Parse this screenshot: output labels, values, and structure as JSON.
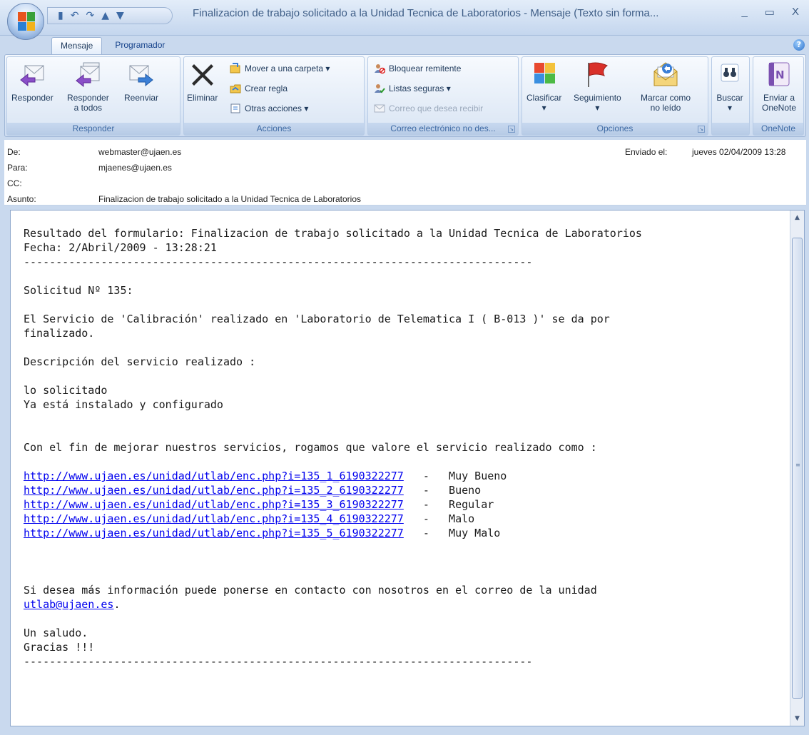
{
  "window": {
    "title": "Finalizacion de trabajo solicitado a la Unidad Tecnica de Laboratorios - Mensaje (Texto sin forma...",
    "minimize": "_",
    "maximize": "▭",
    "close": "X"
  },
  "qat": {
    "save": "▮",
    "undo": "↶",
    "redo": "↷",
    "up": "▲",
    "down": "▼",
    "customize": "₹"
  },
  "tabs": [
    {
      "label": "Mensaje",
      "active": true
    },
    {
      "label": "Programador",
      "active": false
    }
  ],
  "ribbon": {
    "groups": {
      "responder": "Responder",
      "acciones": "Acciones",
      "correo": "Correo electrónico no des...",
      "opciones": "Opciones",
      "buscar": "",
      "onenote": "OneNote"
    },
    "buttons": {
      "responder": "Responder",
      "responder_todos_1": "Responder",
      "responder_todos_2": "a todos",
      "reenviar": "Reenviar",
      "eliminar": "Eliminar",
      "mover": "Mover a una carpeta ▾",
      "crear_regla": "Crear regla",
      "otras_acciones": "Otras acciones ▾",
      "bloquear": "Bloquear remitente",
      "listas_seguras": "Listas seguras ▾",
      "correo_recibir": "Correo que desea recibir",
      "clasificar": "Clasificar",
      "clasificar_arrow": "▾",
      "seguimiento": "Seguimiento",
      "seguimiento_arrow": "▾",
      "marcar_1": "Marcar como",
      "marcar_2": "no leído",
      "buscar": "Buscar",
      "buscar_arrow": "▾",
      "enviar_onenote_1": "Enviar a",
      "enviar_onenote_2": "OneNote"
    }
  },
  "header": {
    "de_label": "De:",
    "de_value": "webmaster@ujaen.es",
    "para_label": "Para:",
    "para_value": "mjaenes@ujaen.es",
    "cc_label": "CC:",
    "cc_value": "",
    "asunto_label": "Asunto:",
    "asunto_value": "Finalizacion de trabajo solicitado a la Unidad Tecnica de Laboratorios",
    "enviado_label": "Enviado el:",
    "enviado_value": "jueves 02/04/2009 13:28"
  },
  "body": {
    "line1": "Resultado del formulario: Finalizacion de trabajo solicitado a la Unidad Tecnica de Laboratorios",
    "line2": "Fecha: 2/Abril/2009 - 13:28:21",
    "separator": "-------------------------------------------------------------------------------",
    "solicitud": "Solicitud Nº 135:",
    "servicio_1": "El Servicio de 'Calibración' realizado en 'Laboratorio de Telematica I ( B-013 )' se da por",
    "servicio_2": "finalizado.",
    "descripcion": "Descripción del servicio realizado :",
    "desc_1": "lo solicitado",
    "desc_2": "Ya está instalado y configurado",
    "valore": "Con el fin de mejorar nuestros servicios, rogamos que valore el servicio realizado como :",
    "ratings": [
      {
        "url": "http://www.ujaen.es/unidad/utlab/enc.php?i=135_1_6190322277",
        "dash": "   -   ",
        "label": "Muy Bueno"
      },
      {
        "url": "http://www.ujaen.es/unidad/utlab/enc.php?i=135_2_6190322277",
        "dash": "   -   ",
        "label": "Bueno"
      },
      {
        "url": "http://www.ujaen.es/unidad/utlab/enc.php?i=135_3_6190322277",
        "dash": "   -   ",
        "label": "Regular"
      },
      {
        "url": "http://www.ujaen.es/unidad/utlab/enc.php?i=135_4_6190322277",
        "dash": "   -   ",
        "label": "Malo"
      },
      {
        "url": "http://www.ujaen.es/unidad/utlab/enc.php?i=135_5_6190322277",
        "dash": "   -   ",
        "label": "Muy Malo"
      }
    ],
    "info": "Si desea más información puede ponerse en contacto con nosotros en el correo de la unidad",
    "email_link": "utlab@ujaen.es",
    "email_tail": ".",
    "saludo": "Un saludo.",
    "gracias": "Gracias !!!",
    "separator_end": "-------------------------------------------------------------------------------"
  },
  "scrollbar": {
    "up": "▲",
    "down": "▼",
    "grip": "≡"
  }
}
